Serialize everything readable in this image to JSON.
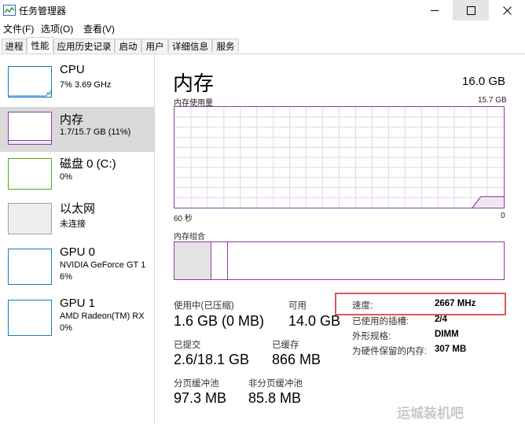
{
  "window": {
    "title": "任务管理器",
    "controls": {
      "minimize": "—",
      "maximize": "□",
      "close": "✕"
    }
  },
  "menu": [
    "文件(F)",
    "选项(O)",
    "查看(V)"
  ],
  "tabs": [
    {
      "label": "进程",
      "active": false
    },
    {
      "label": "性能",
      "active": true
    },
    {
      "label": "应用历史记录",
      "active": false
    },
    {
      "label": "启动",
      "active": false
    },
    {
      "label": "用户",
      "active": false
    },
    {
      "label": "详细信息",
      "active": false
    },
    {
      "label": "服务",
      "active": false
    }
  ],
  "sidebar": {
    "items": [
      {
        "name": "CPU",
        "sub1": "7% 3.69 GHz",
        "sub2": "",
        "color": "#117dbb",
        "selected": false
      },
      {
        "name": "内存",
        "sub1": "1.7/15.7 GB (11%)",
        "sub2": "",
        "color": "#8b3f9c",
        "selected": true
      },
      {
        "name": "磁盘 0 (C:)",
        "sub1": "0%",
        "sub2": "",
        "color": "#4da60c",
        "selected": false
      },
      {
        "name": "以太网",
        "sub1": "未连接",
        "sub2": "",
        "color": "#a0a0a0",
        "selected": false
      },
      {
        "name": "GPU 0",
        "sub1": "NVIDIA GeForce GT 1",
        "sub2": "6%",
        "color": "#117dbb",
        "selected": false
      },
      {
        "name": "GPU 1",
        "sub1": "AMD Radeon(TM) RX",
        "sub2": "0%",
        "color": "#117dbb",
        "selected": false
      }
    ]
  },
  "main": {
    "title": "内存",
    "total": "16.0 GB",
    "usage_graph": {
      "label": "内存使用量",
      "max_label": "15.7 GB",
      "x_left": "60 秒",
      "x_right": "0",
      "current_fraction": 0.11
    },
    "composition": {
      "label": "内存组合",
      "in_use_fraction": 0.11,
      "modified_fraction": 0.05
    },
    "stats": {
      "in_use_label": "使用中(已压缩)",
      "in_use_value": "1.6 GB (0 MB)",
      "available_label": "可用",
      "available_value": "14.0 GB",
      "committed_label": "已提交",
      "committed_value": "2.6/18.1 GB",
      "cached_label": "已缓存",
      "cached_value": "866 MB",
      "paged_label": "分页缓冲池",
      "paged_value": "97.3 MB",
      "nonpaged_label": "非分页缓冲池",
      "nonpaged_value": "85.8 MB"
    },
    "details": [
      {
        "key": "速度:",
        "value": "2667 MHz"
      },
      {
        "key": "已使用的插槽:",
        "value": "2/4"
      },
      {
        "key": "外形规格:",
        "value": "DIMM"
      },
      {
        "key": "为硬件保留的内存:",
        "value": "307 MB"
      }
    ]
  },
  "accent_color": "#8b3f9c",
  "highlight_color": "#e0575d",
  "watermark": "运城装机吧"
}
